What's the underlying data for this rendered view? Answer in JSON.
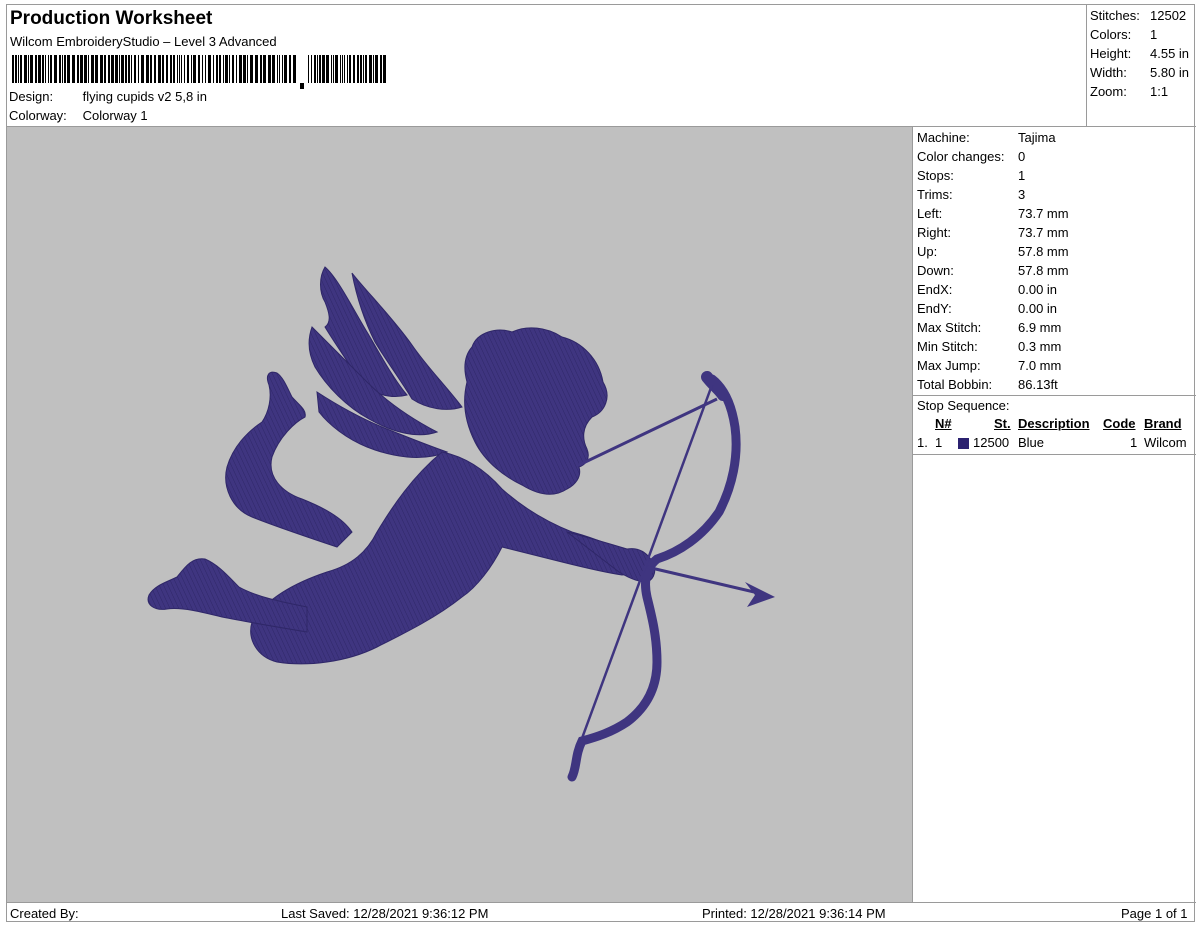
{
  "header": {
    "title": "Production Worksheet",
    "subtitle": "Wilcom EmbroideryStudio – Level 3 Advanced",
    "design_label": "Design:",
    "design_value": "flying cupids v2 5,8 in",
    "colorway_label": "Colorway:",
    "colorway_value": "Colorway 1"
  },
  "stats": [
    {
      "label": "Stitches:",
      "value": "12502"
    },
    {
      "label": "Colors:",
      "value": "1"
    },
    {
      "label": "Height:",
      "value": "4.55 in"
    },
    {
      "label": "Width:",
      "value": "5.80 in"
    },
    {
      "label": "Zoom:",
      "value": "1:1"
    }
  ],
  "info": [
    {
      "label": "Machine:",
      "value": "Tajima"
    },
    {
      "label": "Color changes:",
      "value": "0"
    },
    {
      "label": "Stops:",
      "value": "1"
    },
    {
      "label": "Trims:",
      "value": "3"
    },
    {
      "label": "Left:",
      "value": "73.7 mm"
    },
    {
      "label": "Right:",
      "value": "73.7 mm"
    },
    {
      "label": "Up:",
      "value": "57.8 mm"
    },
    {
      "label": "Down:",
      "value": "57.8 mm"
    },
    {
      "label": "EndX:",
      "value": "0.00 in"
    },
    {
      "label": "EndY:",
      "value": "0.00 in"
    },
    {
      "label": "Max Stitch:",
      "value": "6.9 mm"
    },
    {
      "label": "Min Stitch:",
      "value": "0.3 mm"
    },
    {
      "label": "Max Jump:",
      "value": "7.0 mm"
    },
    {
      "label": "Total Bobbin:",
      "value": "86.13ft"
    }
  ],
  "stop_sequence": {
    "label": "Stop Sequence:",
    "headers": {
      "n": "N#",
      "st": "St.",
      "description": "Description",
      "code": "Code",
      "brand": "Brand"
    },
    "rows": [
      {
        "index": "1.",
        "n": "1",
        "color": "#2b2170",
        "st": "12500",
        "description": "Blue",
        "code": "1",
        "brand": "Wilcom"
      }
    ]
  },
  "design_color": "#3f3580",
  "footer": {
    "created": "Created By:",
    "saved": "Last Saved: 12/28/2021 9:36:12 PM",
    "printed": "Printed: 12/28/2021 9:36:14 PM",
    "page": "Page 1 of 1"
  }
}
